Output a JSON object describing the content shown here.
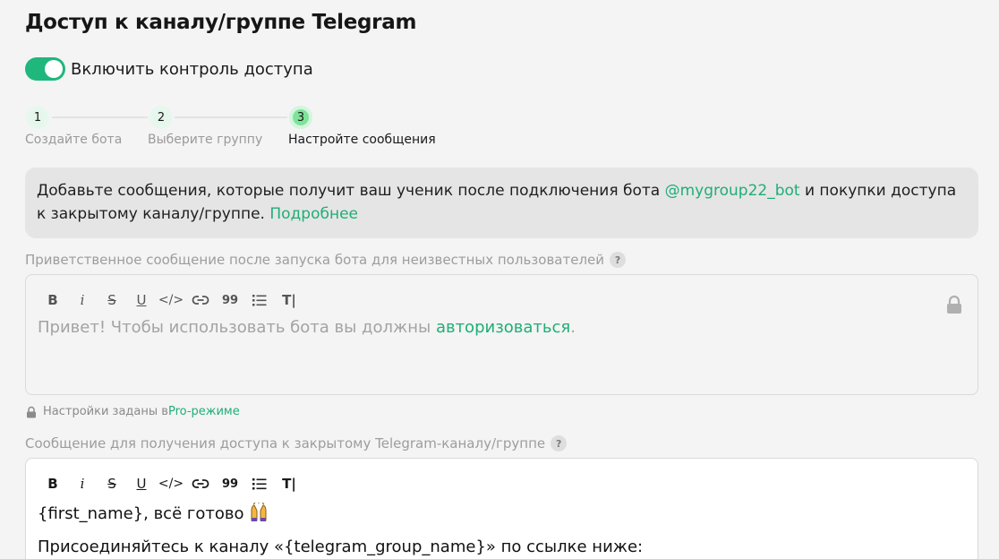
{
  "header": {
    "title": "Доступ к каналу/группе Telegram"
  },
  "access_toggle": {
    "label": "Включить контроль доступа",
    "enabled": true,
    "color": "#1fb77b"
  },
  "steps": [
    {
      "number": "1",
      "label": "Создайте бота",
      "state": "done"
    },
    {
      "number": "2",
      "label": "Выберите группу",
      "state": "done"
    },
    {
      "number": "3",
      "label": "Настройте сообщения",
      "state": "active"
    }
  ],
  "info": {
    "text_1": "Добавьте сообщения, которые получит ваш ученик после подключения бота ",
    "bot_name": "@mygroup22_bot",
    "text_2": " и покупки доступа к закрытому каналу/группе. ",
    "more_link": "Подробнее"
  },
  "welcome_field": {
    "label": "Приветственное сообщение после запуска бота для неизвестных пользователей",
    "help": "?",
    "text_1": "Привет! Чтобы использовать бота вы должны ",
    "link": "авторизоваться",
    "text_2": ".",
    "locked": true
  },
  "pro_note": {
    "text": "Настройки заданы в ",
    "link": "Pro-режиме"
  },
  "access_field": {
    "label": "Сообщение для получения доступа к закрытому Telegram-каналу/группе",
    "help": "?",
    "line_1": "{first_name}, всё готово ",
    "emoji_icon": "raised-hands-emoji",
    "line_2": "Присоединяйтесь к каналу «{telegram_group_name}» по ссылке ниже:"
  },
  "toolbar": {
    "bold": "B",
    "italic": "i",
    "strike": "S",
    "underline": "U",
    "code": "</>",
    "quote": "99",
    "clear": "T|"
  },
  "colors": {
    "accent": "#1fae76",
    "background": "#f4f4f4"
  }
}
